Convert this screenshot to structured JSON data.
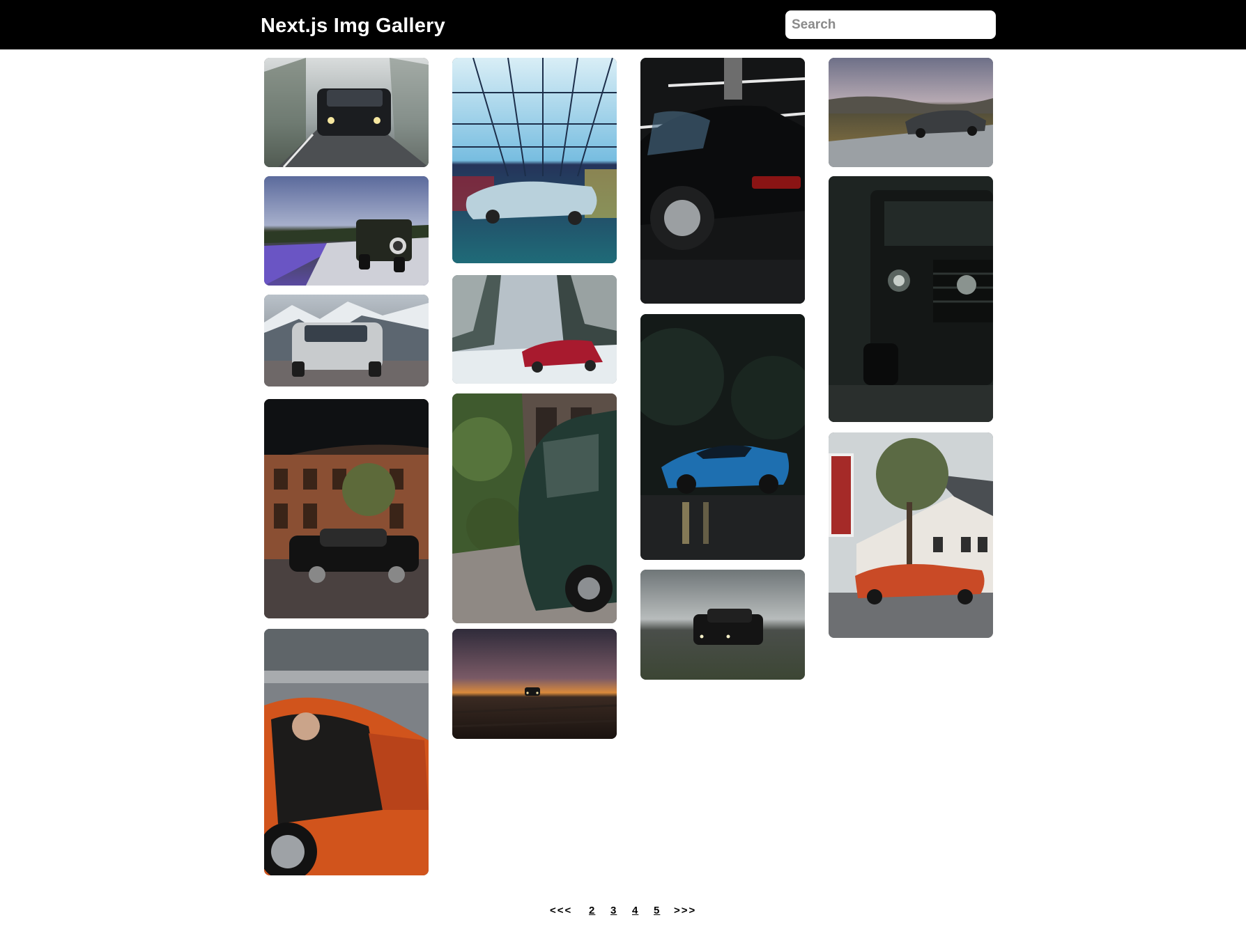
{
  "header": {
    "title": "Next.js Img Gallery",
    "search_placeholder": "Search",
    "search_value": ""
  },
  "gallery": {
    "images": [
      {
        "subject": "dark SUV with headlights on foggy forest road"
      },
      {
        "subject": "off-road jeep beside lavender field"
      },
      {
        "subject": "silver SUV in front of snowy mountains"
      },
      {
        "subject": "black vintage sedan under umbrella on old street"
      },
      {
        "subject": "orange classic sports car with open door"
      },
      {
        "subject": "light blue classic convertible under lit grid ceiling"
      },
      {
        "subject": "red sedan on snowy forest road"
      },
      {
        "subject": "dark green classic car beside overgrown wall"
      },
      {
        "subject": "car on open field at sunset"
      },
      {
        "subject": "black sports car in parking garage"
      },
      {
        "subject": "blue sedan on wet road at night"
      },
      {
        "subject": "black SUV on grassy field at dusk"
      },
      {
        "subject": "dark sedan on moorland road"
      },
      {
        "subject": "black off-road SUV front grille"
      },
      {
        "subject": "orange classic car in front of motel"
      }
    ]
  },
  "pagination": {
    "prev": "<<<",
    "pages": [
      "2",
      "3",
      "4",
      "5"
    ],
    "next": ">>>"
  }
}
